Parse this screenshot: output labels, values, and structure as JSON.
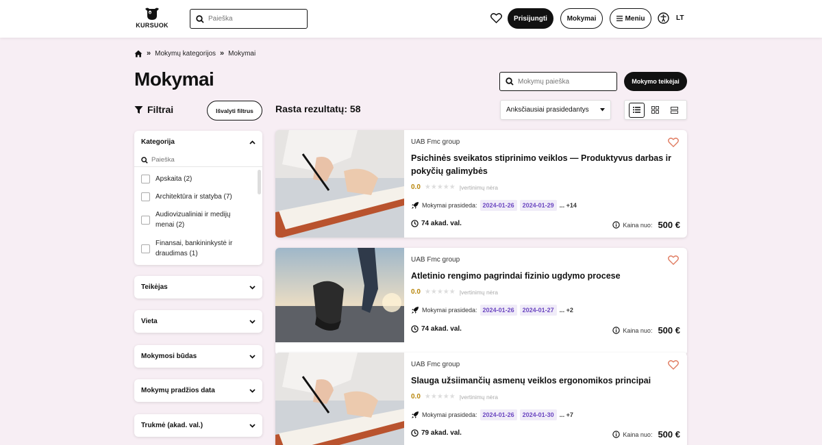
{
  "header": {
    "logo_text": "KURSUOK",
    "search_placeholder": "Paieška",
    "login_label": "Prisijungti",
    "courses_label": "Mokymai",
    "menu_label": "Meniu",
    "lang": "LT"
  },
  "breadcrumb": {
    "sep": "»",
    "items": [
      "Mokymų kategorijos",
      "Mokymai"
    ]
  },
  "page": {
    "title": "Mokymai",
    "course_search_placeholder": "Mokymų paieška",
    "provider_button": "Mokymo teikėjai",
    "filters_label": "Filtrai",
    "clear_filters": "Išvalyti filtrus",
    "results_text": "Rasta rezultatų: 58",
    "sort_value": "Anksčiausiai prasidedantys"
  },
  "sidebar": {
    "category": {
      "title": "Kategorija",
      "search_placeholder": "Paieška",
      "items": [
        "Apskaita (2)",
        "Architektūra ir statyba (7)",
        "Audiovizualiniai ir medijų menai (2)",
        "Finansai, bankininkystė ir draudimas (1)"
      ]
    },
    "panels": [
      "Teikėjas",
      "Vieta",
      "Mokymosi būdas",
      "Mokymų pradžios data",
      "Trukmė (akad. val.)"
    ]
  },
  "labels": {
    "starts": "Mokymai prasideda:",
    "no_rating": "Įvertinimų nėra",
    "price_from": "Kaina nuo:"
  },
  "courses": [
    {
      "provider": "UAB Fmc group",
      "title": "Psichinės sveikatos stiprinimo veiklos — Produktyvus darbas ir pokyčių galimybės",
      "rating": "0.0",
      "dates": [
        "2024-01-26",
        "2024-01-29"
      ],
      "more": "... +14",
      "duration": "74 akad. val.",
      "price": "500 €",
      "image": "notebook-writing"
    },
    {
      "provider": "UAB Fmc group",
      "title": "Atletinio rengimo pagrindai fizinio ugdymo procese",
      "rating": "0.0",
      "dates": [
        "2024-01-26",
        "2024-01-27"
      ],
      "more": "... +2",
      "duration": "74 akad. val.",
      "price": "500 €",
      "image": "runner-start"
    },
    {
      "provider": "UAB Fmc group",
      "title": "Slauga užsiimančių asmenų veiklos ergonomikos principai",
      "rating": "0.0",
      "dates": [
        "2024-01-26",
        "2024-01-30"
      ],
      "more": "... +7",
      "duration": "79 akad. val.",
      "price": "500 €",
      "image": "notebook-writing"
    }
  ]
}
